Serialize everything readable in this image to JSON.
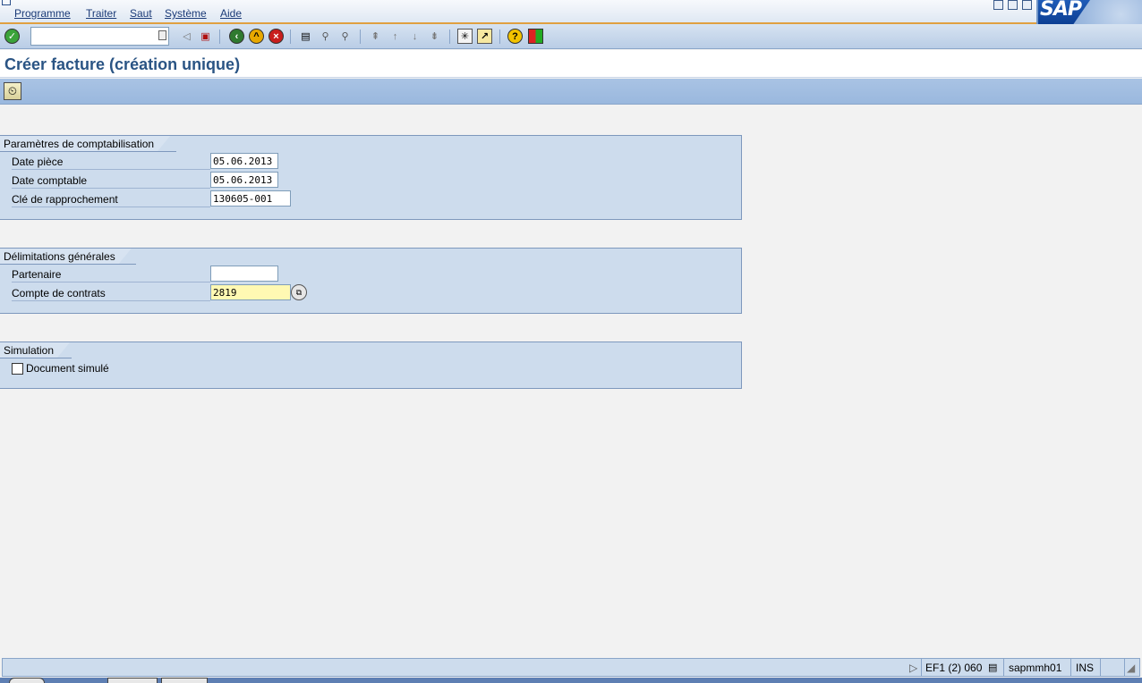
{
  "menu": {
    "items": [
      "Programme",
      "Traiter",
      "Saut",
      "Système",
      "Aide"
    ]
  },
  "logo": {
    "text": "SAP"
  },
  "toolbar": {
    "command_value": "",
    "icons": [
      "enter-icon",
      "back-arrow-icon",
      "save-icon",
      "back-icon",
      "exit-icon",
      "cancel-icon",
      "print-icon",
      "find-icon",
      "find-next-icon",
      "first-page-icon",
      "previous-page-icon",
      "next-page-icon",
      "last-page-icon",
      "new-session-icon",
      "shortcut-icon",
      "help-icon",
      "customize-layout-icon"
    ]
  },
  "page": {
    "title": "Créer facture (création unique)"
  },
  "app_toolbar": {
    "execute_icon": "execute-icon"
  },
  "groups": {
    "posting": {
      "title": "Paramètres de comptabilisation",
      "date_doc_label": "Date pièce",
      "date_doc_value": "05.06.2013",
      "date_post_label": "Date comptable",
      "date_post_value": "05.06.2013",
      "recon_key_label": "Clé de rapprochement",
      "recon_key_value": "130605-001"
    },
    "general": {
      "title": "Délimitations générales",
      "partner_label": "Partenaire",
      "partner_value": "",
      "contract_account_label": "Compte de contrats",
      "contract_account_value": "2819"
    },
    "simulation": {
      "title": "Simulation",
      "simulated_doc_label": "Document simulé",
      "simulated_doc_checked": false
    }
  },
  "status": {
    "system": "EF1 (2) 060",
    "server": "sapmmh01",
    "mode": "INS"
  },
  "colors": {
    "title": "#2a5484",
    "group_bg": "#cddced",
    "active_field": "#fff9b3"
  }
}
